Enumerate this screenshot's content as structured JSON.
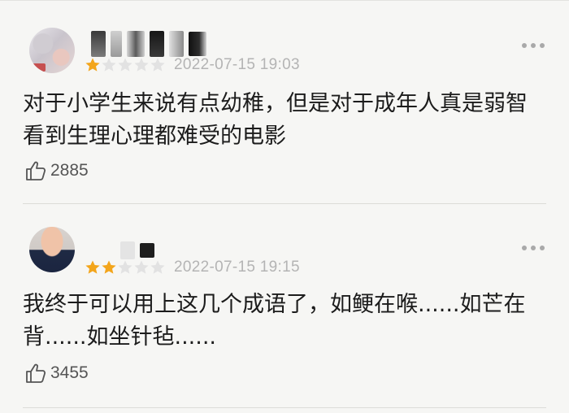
{
  "colors": {
    "background": "#f6f6f4",
    "star_filled": "#f3a51b",
    "star_empty": "#e2e2e2",
    "timestamp": "#b4b4b4",
    "comment_text": "#1c1c1c"
  },
  "reviews": [
    {
      "rating": 1,
      "max_rating": 5,
      "timestamp": "2022-07-15 19:03",
      "comment": "对于小学生来说有点幼稚，但是对于成年人真是弱智 看到生理心理都难受的电影",
      "likes": "2885",
      "like_icon": "thumbs-up-icon",
      "more_icon": "more-dots-icon"
    },
    {
      "rating": 2,
      "max_rating": 5,
      "timestamp": "2022-07-15 19:15",
      "comment": "我终于可以用上这几个成语了，如鲠在喉......如芒在背......如坐针毡......",
      "likes": "3455",
      "like_icon": "thumbs-up-icon",
      "more_icon": "more-dots-icon"
    }
  ]
}
